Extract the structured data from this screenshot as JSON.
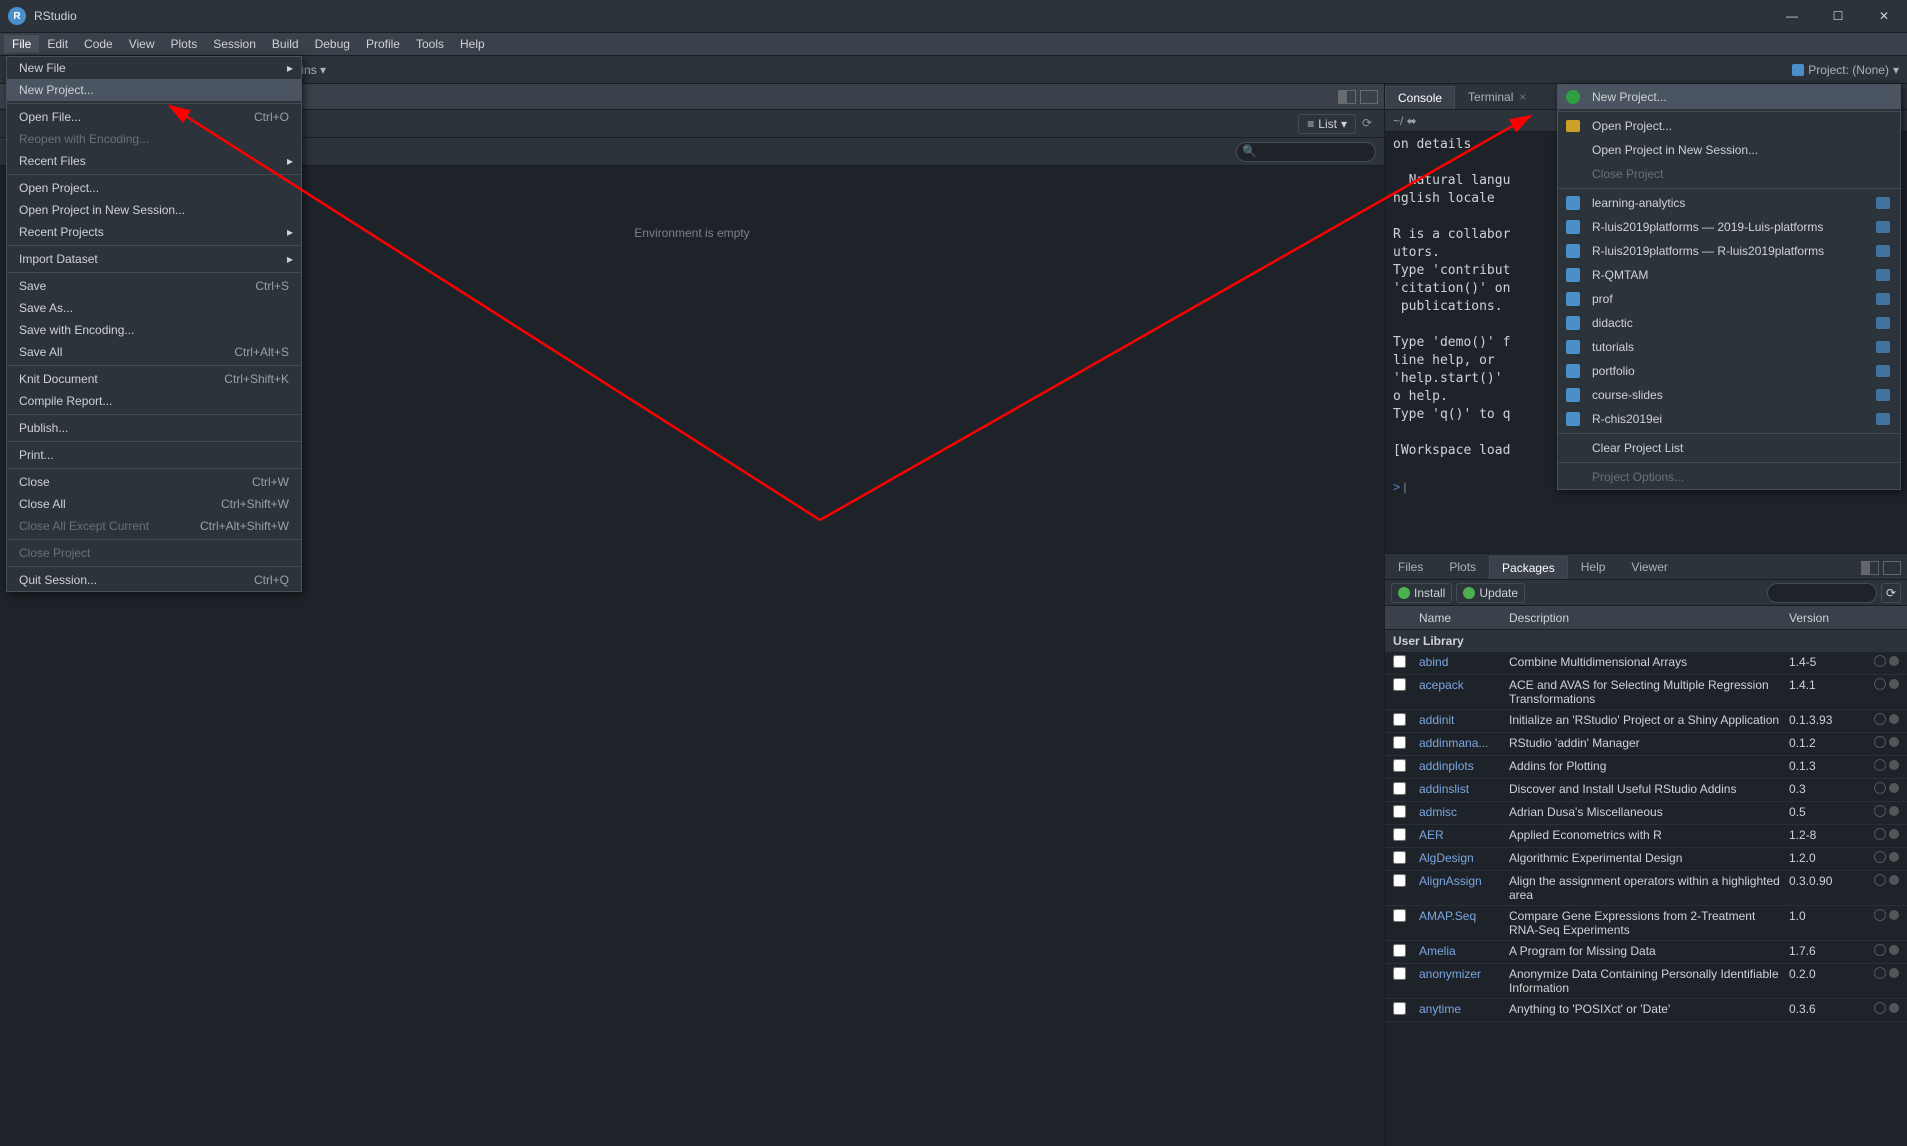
{
  "title": "RStudio",
  "menubar": [
    "File",
    "Edit",
    "Code",
    "View",
    "Plots",
    "Session",
    "Build",
    "Debug",
    "Profile",
    "Tools",
    "Help"
  ],
  "toolbar": {
    "addins": "Addins",
    "project_label": "Project: (None)"
  },
  "env": {
    "list_btn": "List",
    "empty": "Environment is empty",
    "search_ph": ""
  },
  "tabs_env": {
    "history": ""
  },
  "console": {
    "tabs": [
      "Console",
      "Terminal"
    ],
    "path": "~/",
    "lines": [
      "on details.",
      "",
      "  Natural langu",
      "nglish locale",
      "",
      "R is a collabor",
      "utors.",
      "Type 'contribut",
      "'citation()' on",
      " publications.",
      "",
      "Type 'demo()' f",
      "line help, or",
      "'help.start()'",
      "o help.",
      "Type 'q()' to q",
      "",
      "[Workspace load",
      ""
    ],
    "prompt": ">"
  },
  "pkg_tabs": [
    "Files",
    "Plots",
    "Packages",
    "Help",
    "Viewer"
  ],
  "pkg_tool": {
    "install": "Install",
    "update": "Update",
    "search_ph": ""
  },
  "pkg_hdr": {
    "name": "Name",
    "desc": "Description",
    "ver": "Version"
  },
  "pkg_section": "User Library",
  "packages": [
    {
      "n": "abind",
      "d": "Combine Multidimensional Arrays",
      "v": "1.4-5"
    },
    {
      "n": "acepack",
      "d": "ACE and AVAS for Selecting Multiple Regression Transformations",
      "v": "1.4.1"
    },
    {
      "n": "addinit",
      "d": "Initialize an 'RStudio' Project or a Shiny Application",
      "v": "0.1.3.93"
    },
    {
      "n": "addinmana...",
      "d": "RStudio 'addin' Manager",
      "v": "0.1.2"
    },
    {
      "n": "addinplots",
      "d": "Addins for Plotting",
      "v": "0.1.3"
    },
    {
      "n": "addinslist",
      "d": "Discover and Install Useful RStudio Addins",
      "v": "0.3"
    },
    {
      "n": "admisc",
      "d": "Adrian Dusa's Miscellaneous",
      "v": "0.5"
    },
    {
      "n": "AER",
      "d": "Applied Econometrics with R",
      "v": "1.2-8"
    },
    {
      "n": "AlgDesign",
      "d": "Algorithmic Experimental Design",
      "v": "1.2.0"
    },
    {
      "n": "AlignAssign",
      "d": "Align the assignment operators within a highlighted area",
      "v": "0.3.0.90"
    },
    {
      "n": "AMAP.Seq",
      "d": "Compare Gene Expressions from 2-Treatment RNA-Seq Experiments",
      "v": "1.0"
    },
    {
      "n": "Amelia",
      "d": "A Program for Missing Data",
      "v": "1.7.6"
    },
    {
      "n": "anonymizer",
      "d": "Anonymize Data Containing Personally Identifiable Information",
      "v": "0.2.0"
    },
    {
      "n": "anytime",
      "d": "Anything to 'POSIXct' or 'Date'",
      "v": "0.3.6"
    }
  ],
  "file_menu": [
    {
      "l": "New File",
      "sub": true
    },
    {
      "l": "New Project...",
      "hover": true
    },
    {
      "sep": true
    },
    {
      "l": "Open File...",
      "sc": "Ctrl+O"
    },
    {
      "l": "Reopen with Encoding...",
      "dis": true
    },
    {
      "l": "Recent Files",
      "sub": true
    },
    {
      "sep": true
    },
    {
      "l": "Open Project..."
    },
    {
      "l": "Open Project in New Session..."
    },
    {
      "l": "Recent Projects",
      "sub": true
    },
    {
      "sep": true
    },
    {
      "l": "Import Dataset",
      "sub": true
    },
    {
      "sep": true
    },
    {
      "l": "Save",
      "sc": "Ctrl+S"
    },
    {
      "l": "Save As..."
    },
    {
      "l": "Save with Encoding..."
    },
    {
      "l": "Save All",
      "sc": "Ctrl+Alt+S"
    },
    {
      "sep": true
    },
    {
      "l": "Knit Document",
      "sc": "Ctrl+Shift+K"
    },
    {
      "l": "Compile Report..."
    },
    {
      "sep": true
    },
    {
      "l": "Publish..."
    },
    {
      "sep": true
    },
    {
      "l": "Print..."
    },
    {
      "sep": true
    },
    {
      "l": "Close",
      "sc": "Ctrl+W"
    },
    {
      "l": "Close All",
      "sc": "Ctrl+Shift+W"
    },
    {
      "l": "Close All Except Current",
      "sc": "Ctrl+Alt+Shift+W",
      "dis": true
    },
    {
      "sep": true
    },
    {
      "l": "Close Project",
      "dis": true
    },
    {
      "sep": true
    },
    {
      "l": "Quit Session...",
      "sc": "Ctrl+Q"
    }
  ],
  "proj_menu": [
    {
      "l": "New Project...",
      "ic": "new",
      "hover": true
    },
    {
      "sep": true
    },
    {
      "l": "Open Project...",
      "ic": "open"
    },
    {
      "l": "Open Project in New Session..."
    },
    {
      "l": "Close Project",
      "dis": true
    },
    {
      "sep": true
    },
    {
      "l": "learning-analytics",
      "ic": "recent",
      "end": true
    },
    {
      "l": "R-luis2019platforms — 2019-Luis-platforms",
      "ic": "recent",
      "end": true
    },
    {
      "l": "R-luis2019platforms — R-luis2019platforms",
      "ic": "recent",
      "end": true
    },
    {
      "l": "R-QMTAM",
      "ic": "recent",
      "end": true
    },
    {
      "l": "prof",
      "ic": "recent",
      "end": true
    },
    {
      "l": "didactic",
      "ic": "recent",
      "end": true
    },
    {
      "l": "tutorials",
      "ic": "recent",
      "end": true
    },
    {
      "l": "portfolio",
      "ic": "recent",
      "end": true
    },
    {
      "l": "course-slides",
      "ic": "recent",
      "end": true
    },
    {
      "l": "R-chis2019ei",
      "ic": "recent",
      "end": true
    },
    {
      "sep": true
    },
    {
      "l": "Clear Project List"
    },
    {
      "sep": true
    },
    {
      "l": "Project Options...",
      "dis": true
    }
  ]
}
